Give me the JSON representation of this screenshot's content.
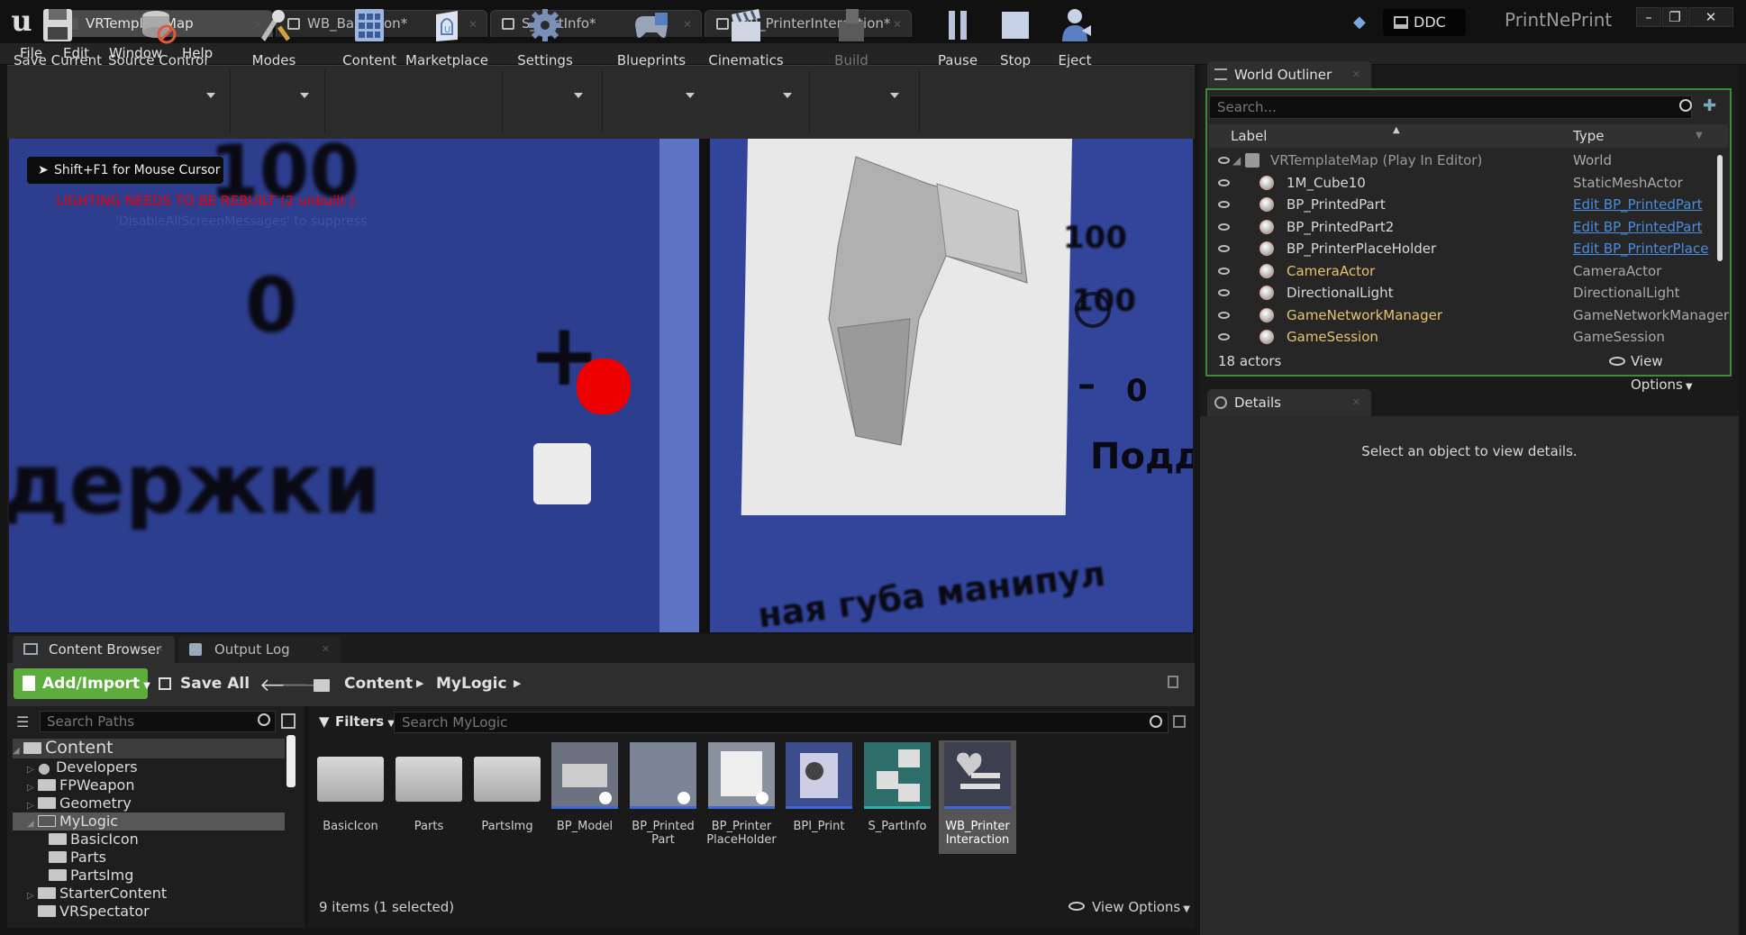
{
  "titlebar": {
    "tabs": [
      {
        "label": "VRTemplateMap"
      },
      {
        "label": "WB_BasicIcon*"
      },
      {
        "label": "S_PartInfo*"
      },
      {
        "label": "WB_PrinterInteraction*"
      }
    ],
    "ddc_label": "DDC",
    "project_name": "PrintNePrint",
    "minimize": "–",
    "maximize": "❐",
    "close": "✕"
  },
  "menu": [
    "File",
    "Edit",
    "Window",
    "Help"
  ],
  "toolbar": {
    "items": [
      {
        "label": "Save Current",
        "icon": "floppy-icon"
      },
      {
        "label": "Source Control",
        "icon": "source-control-icon"
      },
      {
        "label": "Modes",
        "icon": "modes-icon"
      },
      {
        "label": "Content",
        "icon": "content-icon"
      },
      {
        "label": "Marketplace",
        "icon": "marketplace-icon"
      },
      {
        "label": "Settings",
        "icon": "gear-icon"
      },
      {
        "label": "Blueprints",
        "icon": "blueprints-icon"
      },
      {
        "label": "Cinematics",
        "icon": "clapper-icon"
      },
      {
        "label": "Build",
        "icon": "build-icon"
      },
      {
        "label": "Pause",
        "icon": "pause-icon"
      },
      {
        "label": "Stop",
        "icon": "stop-icon"
      },
      {
        "label": "Eject",
        "icon": "eject-icon"
      }
    ]
  },
  "viewport": {
    "hint": "Shift+F1 for Mouse Cursor",
    "warning": "LIGHTING NEEDS TO BE REBUILT (2 unbuilt )",
    "subwarning": "'DisableAllScreenMessages' to suppress",
    "scene_text": {
      "num100": "100",
      "zero": "0",
      "plus": "+",
      "word": "держки",
      "right100a": "100",
      "right100b": "100",
      "minus": "–",
      "right0": "0",
      "rword": "Поддер",
      "bottom": "ная губа манипул"
    }
  },
  "bottom_tabs": [
    {
      "label": "Content Browser"
    },
    {
      "label": "Output Log"
    }
  ],
  "content_browser": {
    "add_import": "Add/Import",
    "save_all": "Save All",
    "breadcrumb": [
      "Content",
      "MyLogic"
    ],
    "search_paths_placeholder": "Search Paths",
    "filters_label": "Filters",
    "search_placeholder": "Search MyLogic",
    "tree": [
      {
        "label": "Content",
        "depth": 0,
        "expanded": true
      },
      {
        "label": "Developers",
        "depth": 1
      },
      {
        "label": "FPWeapon",
        "depth": 1
      },
      {
        "label": "Geometry",
        "depth": 1
      },
      {
        "label": "MyLogic",
        "depth": 1,
        "selected": true
      },
      {
        "label": "BasicIcon",
        "depth": 2
      },
      {
        "label": "Parts",
        "depth": 2
      },
      {
        "label": "PartsImg",
        "depth": 2
      },
      {
        "label": "StarterContent",
        "depth": 1
      },
      {
        "label": "VRSpectator",
        "depth": 1
      }
    ],
    "assets": [
      {
        "name": "BasicIcon",
        "kind": "folder"
      },
      {
        "name": "Parts",
        "kind": "folder"
      },
      {
        "name": "PartsImg",
        "kind": "folder"
      },
      {
        "name": "BP_Model",
        "kind": "blueprint"
      },
      {
        "name": "BP_Printed Part",
        "kind": "blueprint"
      },
      {
        "name": "BP_Printer PlaceHolder",
        "kind": "blueprint"
      },
      {
        "name": "BPI_Print",
        "kind": "interface"
      },
      {
        "name": "S_PartInfo",
        "kind": "struct"
      },
      {
        "name": "WB_Printer Interaction",
        "kind": "widget",
        "selected": true
      }
    ],
    "items_info": "9 items (1 selected)",
    "view_options": "View Options"
  },
  "world_outliner": {
    "tab": "World Outliner",
    "search_placeholder": "Search...",
    "col_label": "Label",
    "col_type": "Type",
    "rows": [
      {
        "label": "VRTemplateMap (Play In Editor)",
        "type": "World",
        "color": "#9a9a9a"
      },
      {
        "label": "1M_Cube10",
        "type": "StaticMeshActor",
        "color": "#d8d8d8"
      },
      {
        "label": "BP_PrintedPart",
        "type": "Edit BP_PrintedPart",
        "link": true,
        "color": "#d8d8d8"
      },
      {
        "label": "BP_PrintedPart2",
        "type": "Edit BP_PrintedPart",
        "link": true,
        "color": "#d8d8d8"
      },
      {
        "label": "BP_PrinterPlaceHolder",
        "type": "Edit BP_PrinterPlace",
        "link": true,
        "color": "#d8d8d8"
      },
      {
        "label": "CameraActor",
        "type": "CameraActor",
        "color": "#e6c46e"
      },
      {
        "label": "DirectionalLight",
        "type": "DirectionalLight",
        "color": "#d8d8d8"
      },
      {
        "label": "GameNetworkManager",
        "type": "GameNetworkManager",
        "color": "#e6c46e"
      },
      {
        "label": "GameSession",
        "type": "GameSession",
        "color": "#e6c46e"
      }
    ],
    "actors_count": "18 actors",
    "view_options": "View Options"
  },
  "details": {
    "tab": "Details",
    "message": "Select an object to view details."
  },
  "colors": {
    "accent_green": "#5cad3b",
    "link_blue": "#4a8de0",
    "warning_red": "#e00000",
    "viewport_blue": "#2e3f8e"
  }
}
